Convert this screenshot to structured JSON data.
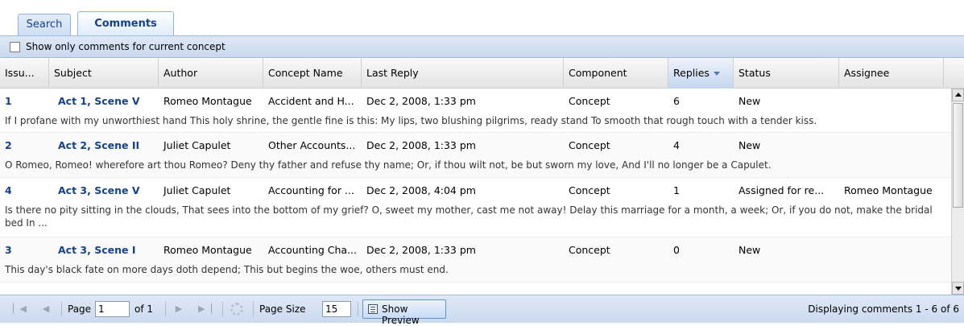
{
  "tabs": [
    {
      "label": "Search",
      "active": false
    },
    {
      "label": "Comments",
      "active": true
    }
  ],
  "filter": {
    "checkbox_label": "Show only comments for current concept",
    "checked": false
  },
  "columns": [
    {
      "label": "Issu..."
    },
    {
      "label": "Subject"
    },
    {
      "label": "Author"
    },
    {
      "label": "Concept Name"
    },
    {
      "label": "Last Reply"
    },
    {
      "label": "Component"
    },
    {
      "label": "Replies",
      "sorted": "desc"
    },
    {
      "label": "Status"
    },
    {
      "label": "Assignee"
    }
  ],
  "rows": [
    {
      "issue": "1",
      "subject": "Act 1, Scene V",
      "author": "Romeo Montague",
      "concept": "Accident and H...",
      "last_reply": "Dec 2, 2008, 1:33 pm",
      "component": "Concept",
      "replies": "6",
      "status": "New",
      "assignee": "",
      "preview": "If I profane with my unworthiest hand This holy shrine, the gentle fine is this: My lips, two blushing pilgrims, ready stand To smooth that rough touch with a tender kiss."
    },
    {
      "issue": "2",
      "subject": "Act 2, Scene II",
      "author": "Juliet Capulet",
      "concept": "Other Accounts...",
      "last_reply": "Dec 2, 2008, 1:33 pm",
      "component": "Concept",
      "replies": "4",
      "status": "New",
      "assignee": "",
      "preview": "O Romeo, Romeo! wherefore art thou Romeo? Deny thy father and refuse thy name; Or, if thou wilt not, be but sworn my love, And I'll no longer be a Capulet."
    },
    {
      "issue": "4",
      "subject": "Act 3, Scene V",
      "author": "Juliet Capulet",
      "concept": "Accounting for ...",
      "last_reply": "Dec 2, 2008, 4:04 pm",
      "component": "Concept",
      "replies": "1",
      "status": "Assigned for re...",
      "assignee": "Romeo Montague",
      "preview": "Is there no pity sitting in the clouds, That sees into the bottom of my grief? O, sweet my mother, cast me not away! Delay this marriage for a month, a week; Or, if you do not, make the bridal bed In ..."
    },
    {
      "issue": "3",
      "subject": "Act 3, Scene I",
      "author": "Romeo Montague",
      "concept": "Accounting Cha...",
      "last_reply": "Dec 2, 2008, 1:33 pm",
      "component": "Concept",
      "replies": "0",
      "status": "New",
      "assignee": "",
      "preview": "This day's black fate on more days doth depend; This but begins the woe, others must end."
    }
  ],
  "pager": {
    "page_label": "Page",
    "page_value": "1",
    "of_label": "of 1",
    "page_size_label": "Page Size",
    "page_size_value": "15",
    "preview_button": "Show Preview",
    "info": "Displaying comments 1 - 6 of 6"
  },
  "icons": {
    "first": "first-page-icon",
    "prev": "prev-page-icon",
    "next": "next-page-icon",
    "last": "last-page-icon",
    "refresh": "refresh-icon",
    "preview": "preview-icon",
    "sort": "sort-desc-icon"
  }
}
